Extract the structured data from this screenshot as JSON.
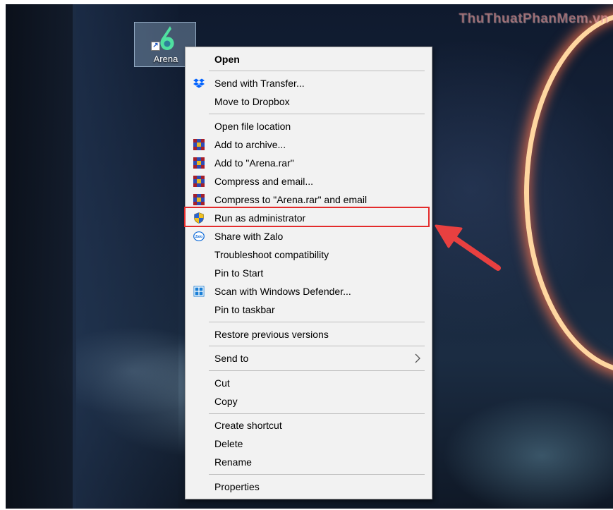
{
  "watermark": "ThuThuatPhanMem.vn",
  "desktop": {
    "shortcut": {
      "label": "Arena",
      "icon": "arena-app-icon"
    }
  },
  "context_menu": {
    "items": [
      {
        "label": "Open",
        "bold": true,
        "icon": null
      },
      {
        "label": "Send with Transfer...",
        "icon": "dropbox-icon"
      },
      {
        "label": "Move to Dropbox",
        "icon": null
      },
      {
        "label": "Open file location",
        "icon": null
      },
      {
        "label": "Add to archive...",
        "icon": "winrar-icon"
      },
      {
        "label": "Add to \"Arena.rar\"",
        "icon": "winrar-icon"
      },
      {
        "label": "Compress and email...",
        "icon": "winrar-icon"
      },
      {
        "label": "Compress to \"Arena.rar\" and email",
        "icon": "winrar-icon"
      },
      {
        "label": "Run as administrator",
        "icon": "uac-shield-icon",
        "highlighted": true
      },
      {
        "label": "Share with Zalo",
        "icon": "zalo-icon"
      },
      {
        "label": "Troubleshoot compatibility",
        "icon": null
      },
      {
        "label": "Pin to Start",
        "icon": null
      },
      {
        "label": "Scan with Windows Defender...",
        "icon": "windows-defender-icon"
      },
      {
        "label": "Pin to taskbar",
        "icon": null
      },
      {
        "label": "Restore previous versions",
        "icon": null
      },
      {
        "label": "Send to",
        "icon": null,
        "submenu": true
      },
      {
        "label": "Cut",
        "icon": null
      },
      {
        "label": "Copy",
        "icon": null
      },
      {
        "label": "Create shortcut",
        "icon": null
      },
      {
        "label": "Delete",
        "icon": null
      },
      {
        "label": "Rename",
        "icon": null
      },
      {
        "label": "Properties",
        "icon": null
      }
    ],
    "zalo_icon_text": "Zalo"
  },
  "colors": {
    "highlight_border": "#e32b2b",
    "arrow": "#e84040",
    "menu_bg": "#f2f2f2",
    "dropbox": "#0061fe",
    "defender": "#1b7fd6"
  }
}
